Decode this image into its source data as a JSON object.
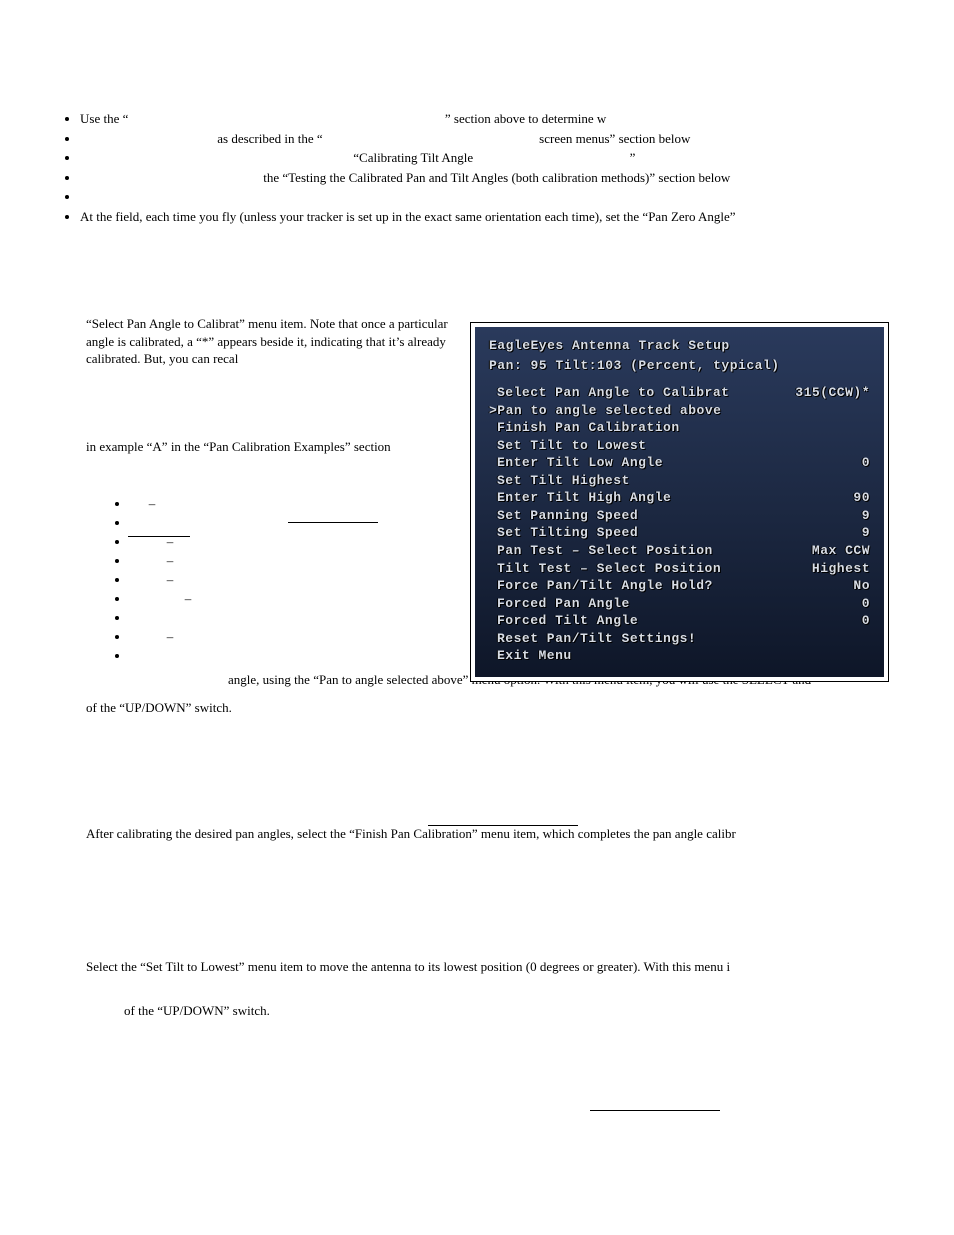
{
  "bullets": {
    "b1a": "Use the “",
    "b1b": "” section above to determine w",
    "b2a": "as described in the “",
    "b2b": "screen menus” section below",
    "b3a": "“Calibrating Tilt Angle",
    "b3b": "”",
    "b4": "the “Testing the Calibrated Pan and Tilt Angles (both calibration methods)” section  below",
    "b6": "At the field, each time you fly (unless your tracker is set up in the exact same orientation each time), set the “Pan Zero Angle”"
  },
  "para1": "“Select Pan Angle to Calibrat” menu item.  Note that once a particular angle is calibrated, a “*” appears beside it, indicating that it’s already calibrated.  But, you can recal",
  "para2": "in example “A” in the “Pan Calibration Examples” section",
  "after_ang": "angle, using the “Pan to angle selected above” menu option. With this menu item, you will use the SELECT and",
  "after_ang2": "of the “UP/DOWN” switch.",
  "finish": "After calibrating the desired pan angles, select the “Finish Pan Calibration” menu item, which completes the pan angle calibr",
  "tilt": "Select the “Set Tilt to Lowest” menu item to move the antenna to its lowest position (0 degrees or greater). With this menu i",
  "tilt2": "of the “UP/DOWN” switch.",
  "dash": "–",
  "osd": {
    "title": "EagleEyes Antenna Track Setup",
    "sub": "Pan: 95 Tilt:103 (Percent, typical)",
    "rows": [
      {
        "l": "Select Pan Angle to Calibrat",
        "v": "315(CCW)*",
        "ind": true
      },
      {
        "l": ">Pan to angle selected above",
        "v": "",
        "sel": true
      },
      {
        "l": "Finish Pan Calibration",
        "v": "",
        "ind": true
      },
      {
        "l": "Set Tilt to Lowest",
        "v": "",
        "ind": true
      },
      {
        "l": "Enter Tilt Low Angle",
        "v": "0",
        "ind": true
      },
      {
        "l": "Set Tilt Highest",
        "v": "",
        "ind": true
      },
      {
        "l": "Enter Tilt High Angle",
        "v": "90",
        "ind": true
      },
      {
        "l": "Set Panning Speed",
        "v": "9",
        "ind": true
      },
      {
        "l": "Set Tilting Speed",
        "v": "9",
        "ind": true
      },
      {
        "l": "Pan Test – Select Position",
        "v": "Max CCW",
        "ind": true
      },
      {
        "l": "Tilt Test – Select Position",
        "v": "Highest",
        "ind": true
      },
      {
        "l": "Force Pan/Tilt Angle Hold?",
        "v": "No",
        "ind": true
      },
      {
        "l": "Forced Pan Angle",
        "v": "0",
        "ind": true
      },
      {
        "l": "Forced Tilt Angle",
        "v": "0",
        "ind": true
      },
      {
        "l": "Reset Pan/Tilt Settings!",
        "v": "",
        "ind": true
      },
      {
        "l": "Exit Menu",
        "v": "",
        "ind": true
      }
    ]
  }
}
